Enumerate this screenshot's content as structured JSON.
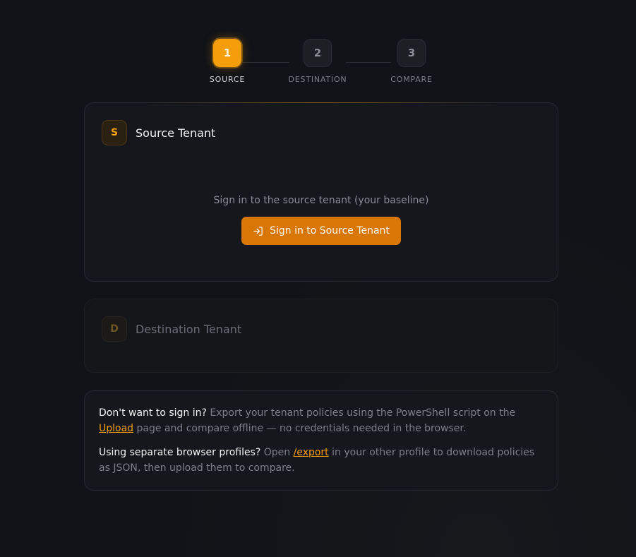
{
  "stepper": {
    "steps": [
      {
        "number": "1",
        "label": "SOURCE",
        "state": "active"
      },
      {
        "number": "2",
        "label": "DESTINATION",
        "state": "inactive"
      },
      {
        "number": "3",
        "label": "COMPARE",
        "state": "inactive"
      }
    ]
  },
  "source_card": {
    "badge": "S",
    "title": "Source Tenant",
    "description": "Sign in to the source tenant (your baseline)",
    "button_label": "Sign in to Source Tenant",
    "button_icon": "sign-in-icon"
  },
  "destination_card": {
    "badge": "D",
    "title": "Destination Tenant"
  },
  "info": {
    "line1": {
      "lead": "Don't want to sign in?",
      "text_before": " Export your tenant policies using the PowerShell script on the ",
      "link": "Upload",
      "text_after": " page and compare offline — no credentials needed in the browser."
    },
    "line2": {
      "lead": "Using separate browser profiles?",
      "text_before": " Open ",
      "link": "/export",
      "text_after": " in your other profile to download policies as JSON, then upload them to compare."
    }
  },
  "colors": {
    "accent": "#f59e0b",
    "button": "#d97706",
    "background": "#111318",
    "card": "#15171c"
  }
}
